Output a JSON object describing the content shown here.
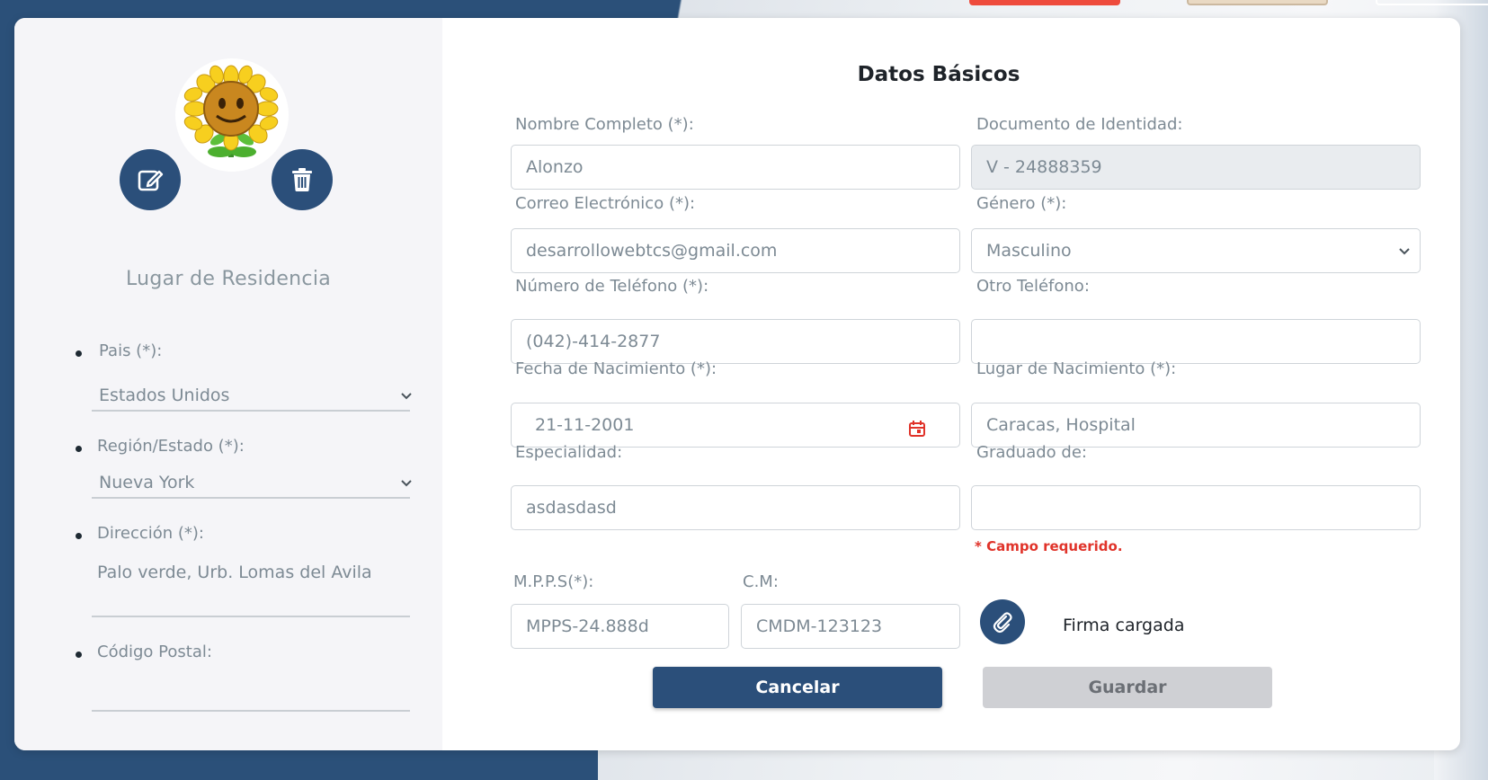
{
  "colors": {
    "brand": "#2b4f7a",
    "error": "#e0332a",
    "panel": "#f5f5f8"
  },
  "profile": {
    "avatar": "sunflower-avatar",
    "edit_icon": "edit-icon",
    "delete_icon": "trash-icon"
  },
  "residence": {
    "title": "Lugar de Residencia",
    "pais_label": "Pais (*):",
    "pais_value": "Estados Unidos",
    "region_label": "Región/Estado (*):",
    "region_value": "Nueva York",
    "direccion_label": "Dirección (*):",
    "direccion_value": "Palo verde, Urb. Lomas del Avila",
    "postal_label": "Código Postal:",
    "postal_value": ""
  },
  "form": {
    "title": "Datos Básicos",
    "nombre_label": "Nombre Completo (*):",
    "nombre_value": "Alonzo",
    "documento_label": "Documento de Identidad:",
    "documento_value": "V - 24888359",
    "correo_label": "Correo Electrónico (*):",
    "correo_value": "desarrollowebtcs@gmail.com",
    "genero_label": "Género (*):",
    "genero_value": "Masculino",
    "telefono_label": "Número de Teléfono (*):",
    "telefono_value": "(042)-414-2877",
    "otro_telefono_label": "Otro Teléfono:",
    "otro_telefono_value": "",
    "fecha_label": "Fecha de Nacimiento (*):",
    "fecha_value": "21-11-2001",
    "lugar_nac_label": "Lugar de Nacimiento (*):",
    "lugar_nac_value": "Caracas, Hospital",
    "especialidad_label": "Especialidad:",
    "especialidad_value": "asdasdasd",
    "graduado_label": "Graduado de:",
    "graduado_value": "",
    "graduado_error": "* Campo requerido.",
    "mpps_label": "M.P.P.S(*):",
    "mpps_value": "MPPS-24.888d",
    "cm_label": "C.M:",
    "cm_value": "CMDM-123123",
    "firma_text": "Firma cargada"
  },
  "actions": {
    "cancel_label": "Cancelar",
    "save_label": "Guardar"
  }
}
